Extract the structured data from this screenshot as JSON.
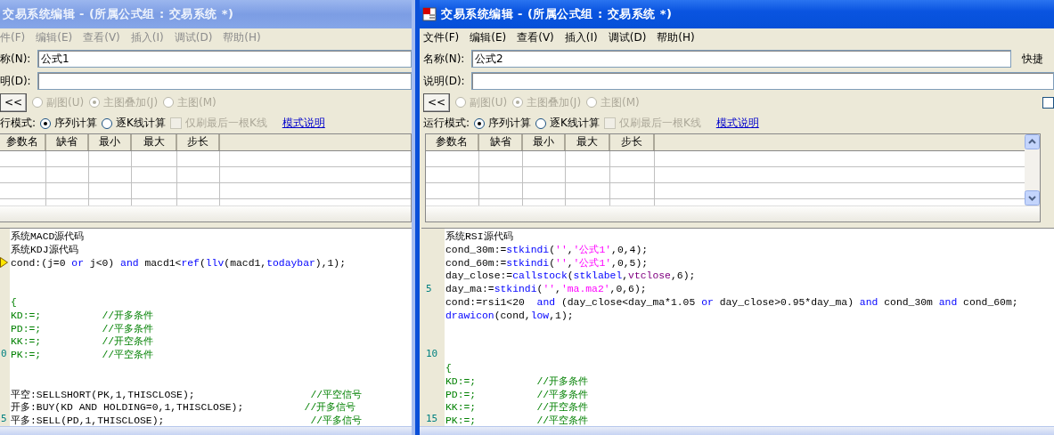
{
  "windows": [
    {
      "active": false,
      "title": "交易系统编辑 - (所属公式组 : 交易系统 *)",
      "menu": [
        "件(F)",
        "编辑(E)",
        "查看(V)",
        "插入(I)",
        "调试(D)",
        "帮助(H)"
      ],
      "name_label": "称(N):",
      "name_value": "公式1",
      "desc_label": "明(D):",
      "collapse_button": "<<",
      "chart_types": [
        {
          "label": "副图(U)",
          "selected": false,
          "disabled": true
        },
        {
          "label": "主图叠加(J)",
          "selected": true,
          "disabled": true
        },
        {
          "label": "主图(M)",
          "selected": false,
          "disabled": true
        }
      ],
      "mode_label": "行模式:",
      "modes": [
        {
          "label": "序列计算",
          "selected": true
        },
        {
          "label": "逐K线计算",
          "selected": false
        }
      ],
      "last_bar_only": {
        "label": "仅刷最后一根K线",
        "checked": false,
        "disabled": true
      },
      "help_link": "模式说明",
      "param_columns": [
        "参数名",
        "缺省",
        "最小",
        "最大",
        "步长"
      ],
      "code_lines": [
        {
          "kind": "code",
          "tokens": [
            {
              "kind": "plain",
              "text": "系统MACD源代码"
            }
          ]
        },
        {
          "kind": "code",
          "tokens": [
            {
              "kind": "plain",
              "text": "系统KDJ源代码"
            }
          ]
        },
        {
          "kind": "code",
          "marker": true,
          "tokens": [
            {
              "kind": "plain",
              "text": "cond:(j=0 "
            },
            {
              "kind": "keyword",
              "text": "or"
            },
            {
              "kind": "plain",
              "text": " j<0) "
            },
            {
              "kind": "keyword",
              "text": "and"
            },
            {
              "kind": "plain",
              "text": " macd1<"
            },
            {
              "kind": "keyword",
              "text": "ref"
            },
            {
              "kind": "plain",
              "text": "("
            },
            {
              "kind": "keyword",
              "text": "llv"
            },
            {
              "kind": "plain",
              "text": "(macd1,"
            },
            {
              "kind": "keyword",
              "text": "todaybar"
            },
            {
              "kind": "plain",
              "text": "),1);"
            }
          ]
        },
        {
          "kind": "blank"
        },
        {
          "kind": "blank"
        },
        {
          "kind": "code",
          "tokens": [
            {
              "kind": "comment",
              "text": "{"
            }
          ]
        },
        {
          "kind": "code",
          "tokens": [
            {
              "kind": "comment",
              "text": "KD:=;          //开多条件"
            }
          ]
        },
        {
          "kind": "code",
          "tokens": [
            {
              "kind": "comment",
              "text": "PD:=;          //平多条件"
            }
          ]
        },
        {
          "kind": "code",
          "tokens": [
            {
              "kind": "comment",
              "text": "KK:=;          //开空条件"
            }
          ]
        },
        {
          "kind": "code",
          "number": "0",
          "tokens": [
            {
              "kind": "comment",
              "text": "PK:=;          //平空条件"
            }
          ]
        },
        {
          "kind": "blank"
        },
        {
          "kind": "blank"
        },
        {
          "kind": "code",
          "tokens": [
            {
              "kind": "plain",
              "text": "平空:SELLSHORT(PK,1,THISCLOSE);                   "
            },
            {
              "kind": "comment",
              "text": "//平空信号"
            }
          ]
        },
        {
          "kind": "code",
          "tokens": [
            {
              "kind": "plain",
              "text": "开多:BUY(KD AND HOLDING=0,1,THISCLOSE);          "
            },
            {
              "kind": "comment",
              "text": "//开多信号"
            }
          ]
        },
        {
          "kind": "code",
          "number": "5",
          "tokens": [
            {
              "kind": "plain",
              "text": "平多:SELL(PD,1,THISCLOSE);                        "
            },
            {
              "kind": "comment",
              "text": "//平多信号"
            }
          ]
        }
      ]
    },
    {
      "active": true,
      "icon": true,
      "title": "交易系统编辑 - (所属公式组 : 交易系统 *)",
      "menu": [
        "文件(F)",
        "编辑(E)",
        "查看(V)",
        "插入(I)",
        "调试(D)",
        "帮助(H)"
      ],
      "name_label": "名称(N):",
      "name_value": "公式2",
      "shortcut_label": "快捷",
      "desc_label": "说明(D):",
      "collapse_button": "<<",
      "chart_types": [
        {
          "label": "副图(U)",
          "selected": false,
          "disabled": true
        },
        {
          "label": "主图叠加(J)",
          "selected": true,
          "disabled": true
        },
        {
          "label": "主图(M)",
          "selected": false,
          "disabled": true
        }
      ],
      "side_checkbox": {
        "checked": false
      },
      "mode_label": "运行模式:",
      "modes": [
        {
          "label": "序列计算",
          "selected": true
        },
        {
          "label": "逐K线计算",
          "selected": false
        }
      ],
      "last_bar_only": {
        "label": "仅刷最后一根K线",
        "checked": false,
        "disabled": true
      },
      "help_link": "模式说明",
      "param_columns": [
        "参数名",
        "缺省",
        "最小",
        "最大",
        "步长"
      ],
      "code_lines": [
        {
          "kind": "code",
          "tokens": [
            {
              "kind": "plain",
              "text": "系统RSI源代码"
            }
          ]
        },
        {
          "kind": "code",
          "tokens": [
            {
              "kind": "plain",
              "text": "cond_30m:="
            },
            {
              "kind": "keyword",
              "text": "stkindi"
            },
            {
              "kind": "plain",
              "text": "("
            },
            {
              "kind": "string",
              "text": "''"
            },
            {
              "kind": "plain",
              "text": ","
            },
            {
              "kind": "string",
              "text": "'公式1'"
            },
            {
              "kind": "plain",
              "text": ",0,4);"
            }
          ]
        },
        {
          "kind": "code",
          "tokens": [
            {
              "kind": "plain",
              "text": "cond_60m:="
            },
            {
              "kind": "keyword",
              "text": "stkindi"
            },
            {
              "kind": "plain",
              "text": "("
            },
            {
              "kind": "string",
              "text": "''"
            },
            {
              "kind": "plain",
              "text": ","
            },
            {
              "kind": "string",
              "text": "'公式1'"
            },
            {
              "kind": "plain",
              "text": ",0,5);"
            }
          ]
        },
        {
          "kind": "code",
          "tokens": [
            {
              "kind": "plain",
              "text": "day_close:="
            },
            {
              "kind": "keyword",
              "text": "callstock"
            },
            {
              "kind": "plain",
              "text": "("
            },
            {
              "kind": "keyword",
              "text": "stklabel"
            },
            {
              "kind": "plain",
              "text": ","
            },
            {
              "kind": "variable",
              "text": "vtclose"
            },
            {
              "kind": "plain",
              "text": ",6);"
            }
          ]
        },
        {
          "kind": "code",
          "number": "5",
          "tokens": [
            {
              "kind": "plain",
              "text": "day_ma:="
            },
            {
              "kind": "keyword",
              "text": "stkindi"
            },
            {
              "kind": "plain",
              "text": "("
            },
            {
              "kind": "string",
              "text": "''"
            },
            {
              "kind": "plain",
              "text": ","
            },
            {
              "kind": "string",
              "text": "'ma.ma2'"
            },
            {
              "kind": "plain",
              "text": ",0,6);"
            }
          ]
        },
        {
          "kind": "code",
          "tokens": [
            {
              "kind": "plain",
              "text": "cond:=rsi1<20  "
            },
            {
              "kind": "keyword",
              "text": "and"
            },
            {
              "kind": "plain",
              "text": " (day_close<day_ma*1.05 "
            },
            {
              "kind": "keyword",
              "text": "or"
            },
            {
              "kind": "plain",
              "text": " day_close>0.95*day_ma) "
            },
            {
              "kind": "keyword",
              "text": "and"
            },
            {
              "kind": "plain",
              "text": " cond_30m "
            },
            {
              "kind": "keyword",
              "text": "and"
            },
            {
              "kind": "plain",
              "text": " cond_60m;"
            }
          ]
        },
        {
          "kind": "code",
          "tokens": [
            {
              "kind": "keyword",
              "text": "drawicon"
            },
            {
              "kind": "plain",
              "text": "(cond,"
            },
            {
              "kind": "keyword",
              "text": "low"
            },
            {
              "kind": "plain",
              "text": ",1);"
            }
          ]
        },
        {
          "kind": "blank"
        },
        {
          "kind": "blank"
        },
        {
          "kind": "blank",
          "number": "10"
        },
        {
          "kind": "code",
          "tokens": [
            {
              "kind": "comment",
              "text": "{"
            }
          ]
        },
        {
          "kind": "code",
          "tokens": [
            {
              "kind": "comment",
              "text": "KD:=;          //开多条件"
            }
          ]
        },
        {
          "kind": "code",
          "tokens": [
            {
              "kind": "comment",
              "text": "PD:=;          //平多条件"
            }
          ]
        },
        {
          "kind": "code",
          "tokens": [
            {
              "kind": "comment",
              "text": "KK:=;          //开空条件"
            }
          ]
        },
        {
          "kind": "code",
          "number": "15",
          "tokens": [
            {
              "kind": "comment",
              "text": "PK:=;          //平空条件"
            }
          ]
        }
      ]
    }
  ]
}
